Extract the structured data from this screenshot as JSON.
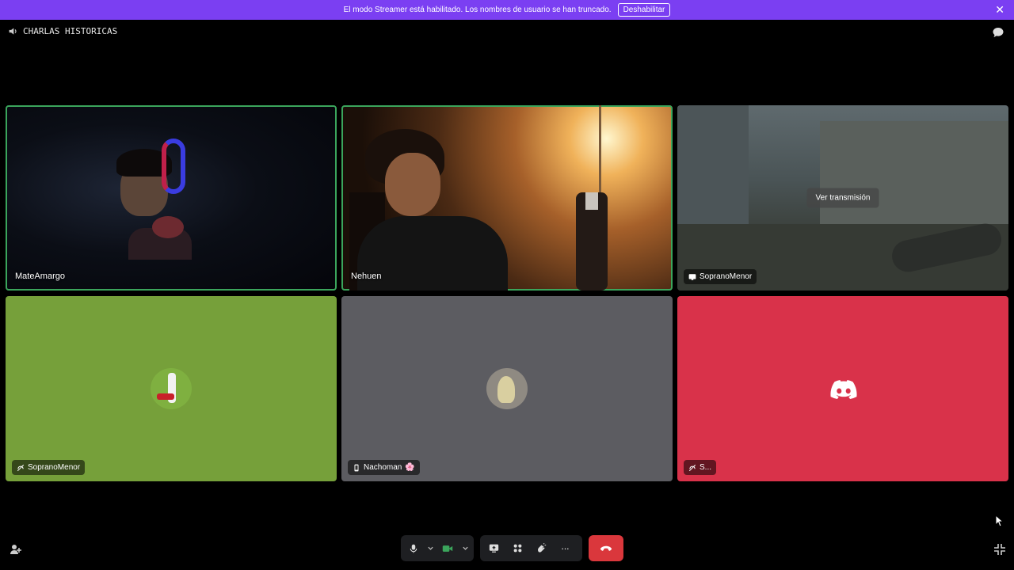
{
  "banner": {
    "message": "El modo Streamer está habilitado. Los nombres de usuario se han truncado.",
    "disable_label": "Deshabilitar",
    "close_glyph": "✕"
  },
  "channel": {
    "name": "CHARLAS HISTORICAS",
    "icon": "speaker-icon"
  },
  "tiles": [
    {
      "name": "MateAmargo",
      "type": "video",
      "speaking": true
    },
    {
      "name": "Nehuen",
      "type": "video",
      "speaking": true
    },
    {
      "name": "SopranoMenor",
      "type": "stream",
      "watch_label": "Ver transmisión",
      "icon": "screen-share-icon"
    },
    {
      "name": "SopranoMenor",
      "type": "avatar",
      "bg": "#76a03a",
      "icon": "deafened-icon"
    },
    {
      "name": "Nachoman",
      "type": "avatar",
      "bg": "#5c5c61",
      "icon": "mobile-icon",
      "badge": "🌸"
    },
    {
      "name": "S...",
      "type": "discord",
      "bg": "#d9324a",
      "icon": "deafened-icon"
    }
  ],
  "toolbar": {
    "mic": "microphone-icon",
    "camera": "camera-icon",
    "share": "screen-share-icon",
    "activities": "activities-icon",
    "soundboard": "soundboard-icon",
    "more_glyph": "···",
    "leave": "hangup-icon"
  },
  "colors": {
    "banner": "#7b3ff2",
    "speaking": "#3ba55c",
    "leave": "#da373c",
    "camera_on": "#3ba55c"
  }
}
